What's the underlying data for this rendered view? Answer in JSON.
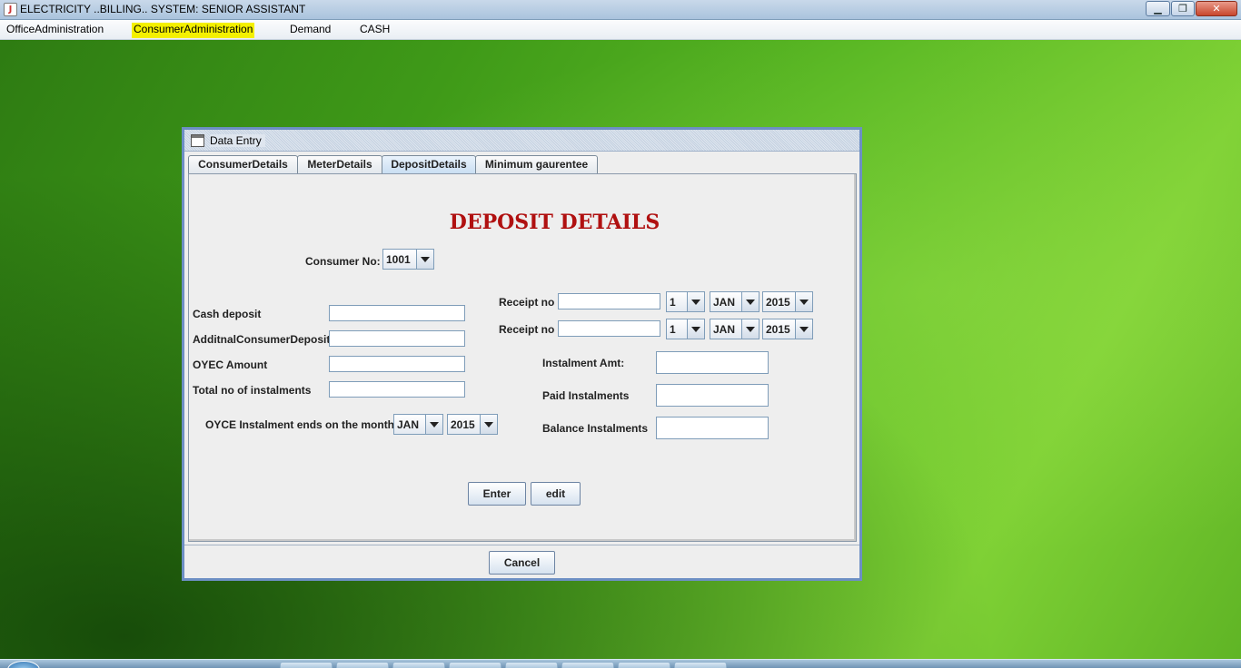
{
  "window": {
    "title": "ELECTRICITY ..BILLING.. SYSTEM: SENIOR ASSISTANT",
    "minimize_glyph": "▁",
    "maximize_glyph": "❐",
    "close_glyph": "✕"
  },
  "menubar": {
    "items": [
      "OfficeAdministration",
      "ConsumerAdministration",
      "Demand",
      "CASH"
    ],
    "highlighted": "ConsumerAdministration",
    "highlight_color": "#f4f000"
  },
  "dialog": {
    "title": "Data Entry",
    "tabs": [
      "ConsumerDetails",
      "MeterDetails",
      "DepositDetails",
      "Minimum gaurentee"
    ],
    "active_tab": "DepositDetails",
    "heading": "DEPOSIT DETAILS",
    "heading_color": "#b01010",
    "consumer_no": {
      "label": "Consumer No:",
      "value": "1001"
    },
    "left_fields": {
      "cash_deposit": "Cash deposit",
      "additional_deposit": "AdditnalConsumerDeposit",
      "oyec_amount": "OYEC Amount",
      "total_instalments": "Total no of instalments"
    },
    "instalment_end": {
      "label": "OYCE Instalment ends on the month",
      "month": "JAN",
      "year": "2015"
    },
    "receipts": [
      {
        "label": "Receipt no",
        "value": "",
        "day": "1",
        "month": "JAN",
        "year": "2015"
      },
      {
        "label": "Receipt no",
        "value": "",
        "day": "1",
        "month": "JAN",
        "year": "2015"
      }
    ],
    "right_fields": {
      "instalment_amt": "Instalment Amt:",
      "paid_instalments": "Paid Instalments",
      "balance_instalments": "Balance Instalments"
    },
    "buttons": {
      "enter": "Enter",
      "edit": "edit",
      "cancel": "Cancel"
    }
  }
}
